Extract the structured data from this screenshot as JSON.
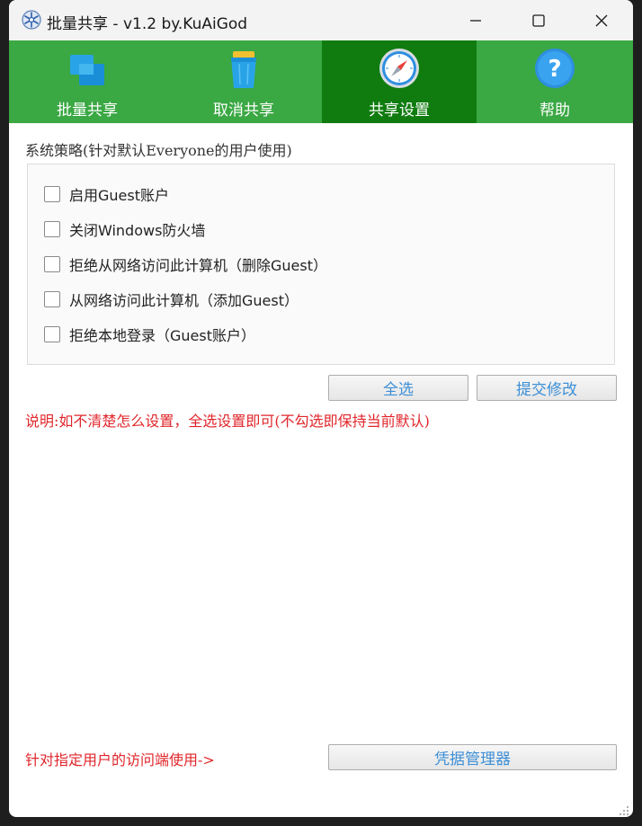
{
  "window": {
    "title": "批量共享 - v1.2 by.KuAiGod"
  },
  "tabs": [
    {
      "label": "批量共享",
      "icon": "windows-share-icon",
      "active": false
    },
    {
      "label": "取消共享",
      "icon": "trash-icon",
      "active": false
    },
    {
      "label": "共享设置",
      "icon": "compass-icon",
      "active": true
    },
    {
      "label": "帮助",
      "icon": "help-icon",
      "active": false
    }
  ],
  "policy": {
    "title": "系统策略(针对默认Everyone的用户使用)",
    "options": [
      {
        "label": "启用Guest账户",
        "checked": false
      },
      {
        "label": "关闭Windows防火墙",
        "checked": false
      },
      {
        "label": "拒绝从网络访问此计算机（删除Guest）",
        "checked": false
      },
      {
        "label": "从网络访问此计算机（添加Guest）",
        "checked": false
      },
      {
        "label": "拒绝本地登录（Guest账户）",
        "checked": false
      }
    ]
  },
  "buttons": {
    "select_all": "全选",
    "submit": "提交修改",
    "credential_manager": "凭据管理器"
  },
  "notes": {
    "explanation": "说明:如不清楚怎么设置，全选设置即可(不勾选即保持当前默认)",
    "footer": "针对指定用户的访问端使用->"
  },
  "colors": {
    "tab_bar": "#3aa843",
    "tab_active": "#107c10",
    "note_red": "#e0262b",
    "button_text": "#3d8fd6"
  }
}
